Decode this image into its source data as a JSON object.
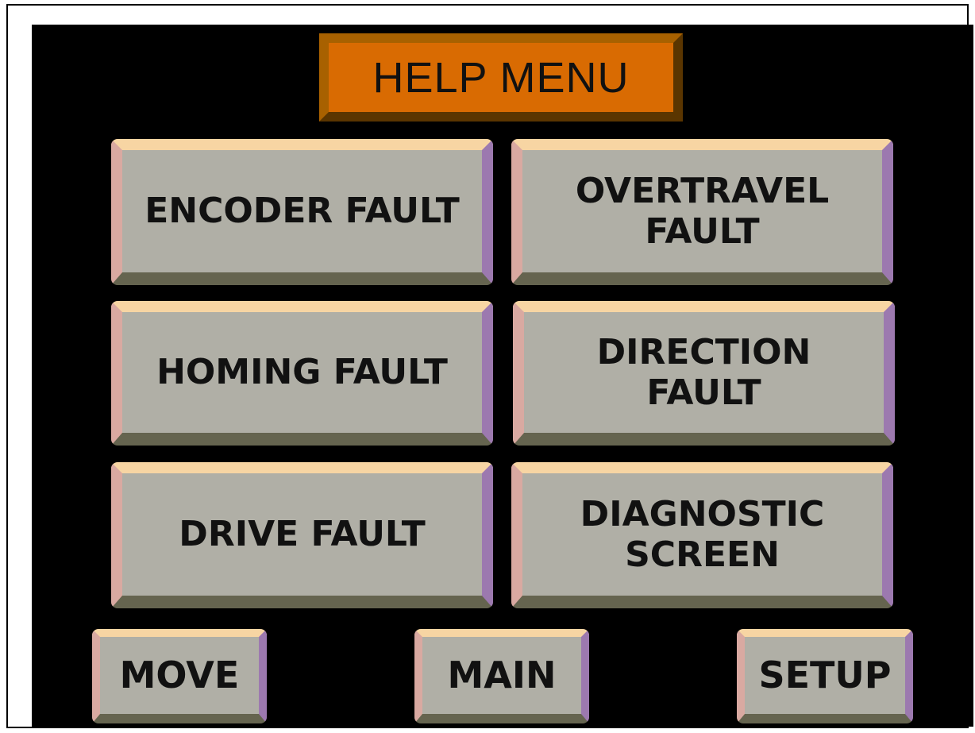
{
  "title": "HELP MENU",
  "fault_buttons": {
    "encoder": "ENCODER FAULT",
    "overtravel": "OVERTRAVEL\nFAULT",
    "homing": "HOMING FAULT",
    "direction": "DIRECTION\nFAULT",
    "drive": "DRIVE FAULT",
    "diagnostic": "DIAGNOSTIC\nSCREEN"
  },
  "nav_buttons": {
    "move": "MOVE",
    "main": "MAIN",
    "setup": "SETUP"
  },
  "colors": {
    "background": "#000000",
    "title_plate": "#d96b02",
    "button_face": "#b0afa6",
    "button_highlight_top": "#f7d5a3",
    "button_highlight_left": "#d9a9a1",
    "button_shadow_right": "#9c79af",
    "button_shadow_bottom": "#65644f"
  }
}
